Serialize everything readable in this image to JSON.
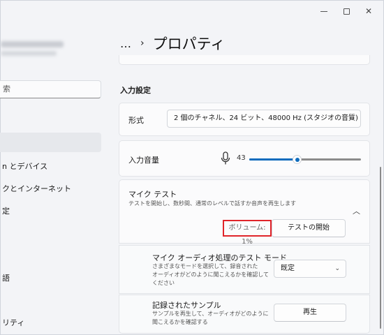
{
  "window": {
    "controls": {
      "minimize": "minimize-icon",
      "maximize": "maximize-icon",
      "close": "✕"
    }
  },
  "sidebar": {
    "search_text": "索",
    "items": [
      {
        "label": "n とデバイス"
      },
      {
        "label": "クとインターネット"
      },
      {
        "label": "定"
      },
      {
        "label": "語"
      },
      {
        "label": "リティ"
      }
    ]
  },
  "header": {
    "dots": "…",
    "chevron": "›",
    "title": "プロパティ"
  },
  "input_settings": {
    "section_title": "入力設定",
    "format": {
      "label": "形式",
      "value": "2 個のチャネル、24 ビット、48000 Hz (スタジオの音質)",
      "chevron": "⌄"
    },
    "volume": {
      "label": "入力音量",
      "value": "43",
      "level_percent": 43,
      "accent_color": "#0f6cbd"
    }
  },
  "mic_test": {
    "title": "マイク テスト",
    "description": "テストを開始し、数秒間、通常のレベルで話すか音声を再生します",
    "collapse_chevron": "︿",
    "volume_readout": "ボリューム: 1%",
    "start_button": "テストの開始",
    "highlight_color": "#e0242a"
  },
  "audio_mode": {
    "title": "マイク オーディオ処理のテスト モード",
    "description_lines": [
      "さまざまなモードを選択して、録音された",
      "オーディオがどのように聞こえるかを確認して",
      "ください"
    ],
    "value": "既定",
    "chevron": "⌄"
  },
  "recorded_sample": {
    "title": "記録されたサンプル",
    "description_lines": [
      "サンプルを再生して、オーディオがどのように",
      "聞こえるかを確認する"
    ],
    "play_button": "再生"
  }
}
